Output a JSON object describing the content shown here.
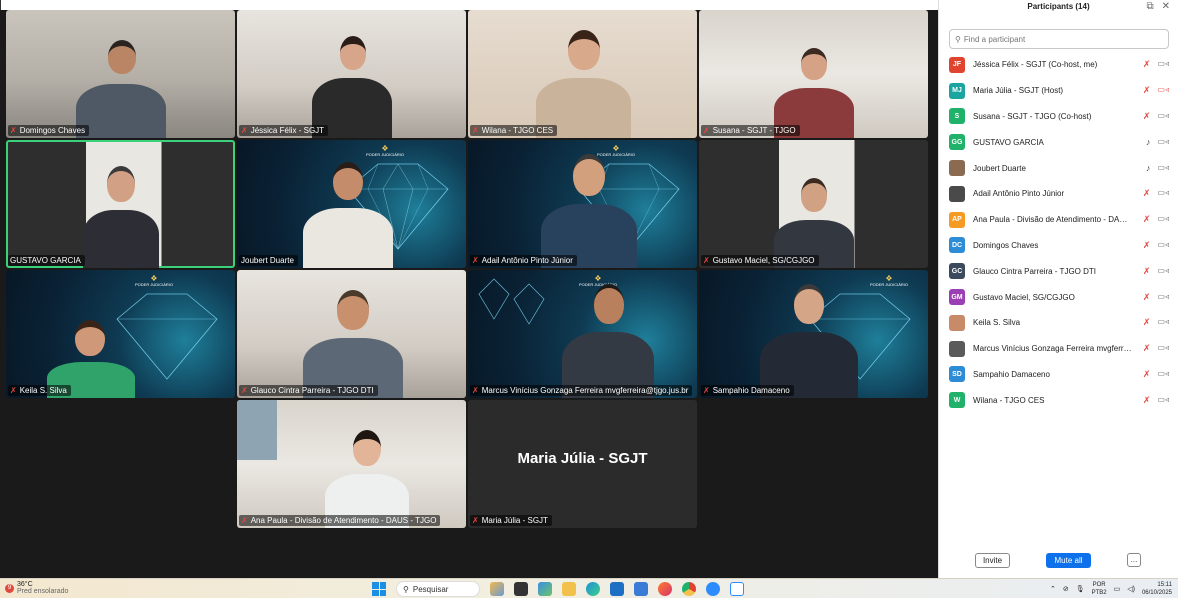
{
  "gallery": {
    "tiles": [
      {
        "name": "Domingos Chaves",
        "mic_off": true
      },
      {
        "name": "Jéssica Félix - SGJT",
        "mic_off": true
      },
      {
        "name": "Wilana - TJGO CES",
        "mic_off": true
      },
      {
        "name": "Susana - SGJT - TJGO",
        "mic_off": true
      },
      {
        "name": "GUSTAVO GARCIA",
        "mic_off": false
      },
      {
        "name": "Joubert Duarte",
        "mic_off": false
      },
      {
        "name": "Adail Antônio Pinto Júnior",
        "mic_off": true
      },
      {
        "name": "Gustavo Maciel, SG/CGJGO",
        "mic_off": true
      },
      {
        "name": "Keila S. Silva",
        "mic_off": true
      },
      {
        "name": "Glauco Cintra Parreira - TJGO DTI",
        "mic_off": true
      },
      {
        "name": "Marcus Vinícius Gonzaga Ferreira mvgferreira@tjgo.jus.br",
        "mic_off": true
      },
      {
        "name": "Sampahio Damaceno",
        "mic_off": true
      },
      {
        "name": "Ana Paula - Divisão de Atendimento - DAUS - TJGO",
        "mic_off": true
      },
      {
        "name": "Maria Júlia - SGJT",
        "mic_off": true
      }
    ],
    "big_name": "Maria Júlia - SGJT",
    "logo_text": "PODER JUDICIÁRIO"
  },
  "panel": {
    "title": "Participants (14)",
    "search_placeholder": "Find a participant",
    "invite_label": "Invite",
    "mute_all_label": "Mute all",
    "more_label": "...",
    "participants": [
      {
        "initials": "JF",
        "name": "Jéssica Félix - SGJT (Co-host, me)",
        "color": "#e0442f",
        "mic": "off",
        "cam": "on"
      },
      {
        "initials": "MJ",
        "name": "Maria Júlia - SGJT (Host)",
        "color": "#1aa5a0",
        "mic": "off",
        "cam": "off"
      },
      {
        "initials": "S",
        "name": "Susana - SGJT - TJGO (Co-host)",
        "color": "#20b26b",
        "mic": "off",
        "cam": "on"
      },
      {
        "initials": "GG",
        "name": "GUSTAVO GARCIA",
        "color": "#20b26b",
        "mic": "on",
        "cam": "on"
      },
      {
        "initials": "",
        "name": "Joubert Duarte",
        "color": "#8b6a52",
        "mic": "on-outline",
        "cam": "on"
      },
      {
        "initials": "",
        "name": "Adail Antônio Pinto Júnior",
        "color": "#4a4a4a",
        "mic": "off",
        "cam": "on"
      },
      {
        "initials": "AP",
        "name": "Ana Paula - Divisão de Atendimento - DAUS...",
        "color": "#f59a23",
        "mic": "off",
        "cam": "on"
      },
      {
        "initials": "DC",
        "name": "Domingos Chaves",
        "color": "#2d8cd6",
        "mic": "off",
        "cam": "on"
      },
      {
        "initials": "GC",
        "name": "Glauco Cintra Parreira - TJGO DTI",
        "color": "#3b4a5c",
        "mic": "off",
        "cam": "on"
      },
      {
        "initials": "GM",
        "name": "Gustavo Maciel, SG/CGJGO",
        "color": "#9b3fb5",
        "mic": "off",
        "cam": "on"
      },
      {
        "initials": "",
        "name": "Keila S. Silva",
        "color": "#c98a6a",
        "mic": "off",
        "cam": "on"
      },
      {
        "initials": "",
        "name": "Marcus Vinícius Gonzaga Ferreira mvgferrei...",
        "color": "#5a5a5a",
        "mic": "off",
        "cam": "on"
      },
      {
        "initials": "SD",
        "name": "Sampahio Damaceno",
        "color": "#2d8cd6",
        "mic": "off",
        "cam": "on"
      },
      {
        "initials": "W",
        "name": "Wilana - TJGO CES",
        "color": "#20b26b",
        "mic": "off",
        "cam": "on"
      }
    ]
  },
  "taskbar": {
    "weather_badge": "9",
    "temperature": "36°C",
    "condition": "Pred ensolarado",
    "search_label": "Pesquisar",
    "lang_top": "POR",
    "lang_bottom": "PTB2",
    "time": "15:11",
    "date": "06/10/2025"
  }
}
